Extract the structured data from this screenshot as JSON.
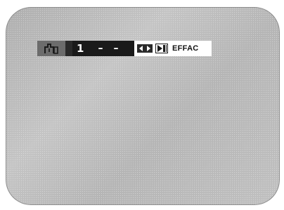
{
  "osd": {
    "mode_icon": "program-mode-icon",
    "track_number": "1",
    "slot_1": "–",
    "slot_2": "–",
    "nav_icon": "left-right-arrows-icon",
    "skip_icon": "skip-next-icon",
    "action_label": "EFFAC"
  },
  "colors": {
    "screen": "#b8b8b8",
    "mode_box": "#6c6c6c",
    "track_box": "#1a1a1a",
    "action_box": "#ffffff",
    "text_light": "#ffffff",
    "text_dark": "#111111"
  }
}
